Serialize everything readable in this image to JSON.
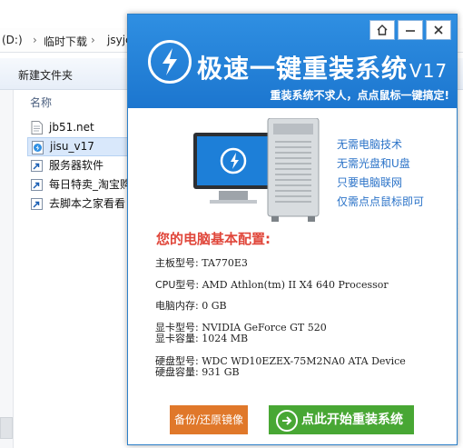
{
  "explorer": {
    "address": {
      "drive": "(D:)",
      "sep1": "›",
      "folder": "临时下载",
      "sep2": "›",
      "sub": "jsyjc"
    },
    "toolbar": {
      "new_folder": "新建文件夹"
    },
    "column_name": "名称",
    "files": [
      {
        "name": "jb51.net",
        "icon": "text-file-icon"
      },
      {
        "name": "jisu_v17",
        "icon": "app-icon",
        "selected": true
      },
      {
        "name": "服务器软件",
        "icon": "shortcut-icon"
      },
      {
        "name": "每日特卖_淘宝购",
        "icon": "shortcut-icon"
      },
      {
        "name": "去脚本之家看看",
        "icon": "shortcut-icon"
      }
    ],
    "right_edge": [
      "t",
      "t",
      "t",
      "t"
    ]
  },
  "dialog": {
    "title": "极速一键重装系统",
    "version": "V17",
    "slogan": "重装系统不求人，点点鼠标一键搞定!",
    "features": [
      "无需电脑技术",
      "无需光盘和U盘",
      "只要电脑联网",
      "仅需点点鼠标即可"
    ],
    "config_title": "您的电脑基本配置:",
    "config": {
      "board_label": "主板型号:",
      "board_value": "TA770E3",
      "cpu_label": "CPU型号:",
      "cpu_value": "AMD Athlon(tm) II X4 640 Processor",
      "mem_label": "电脑内存:",
      "mem_value": "0 GB",
      "gpu_label": "显卡型号:",
      "gpu_value": "NVIDIA GeForce GT 520",
      "vram_label": "显卡容量:",
      "vram_value": "1024 MB",
      "disk_label": "硬盘型号:",
      "disk_value": "WDC WD10EZEX-75M2NA0 ATA Device",
      "disk_size_label": "硬盘容量:",
      "disk_size_value": "931 GB"
    },
    "buttons": {
      "backup": "备份/还原镜像",
      "install": "点此开始重装系统"
    },
    "colors": {
      "banner": "#1f7ed6",
      "accent_red": "#e0463a",
      "feature_blue": "#2b73c8",
      "backup": "#e0782a",
      "install": "#48a734"
    }
  }
}
